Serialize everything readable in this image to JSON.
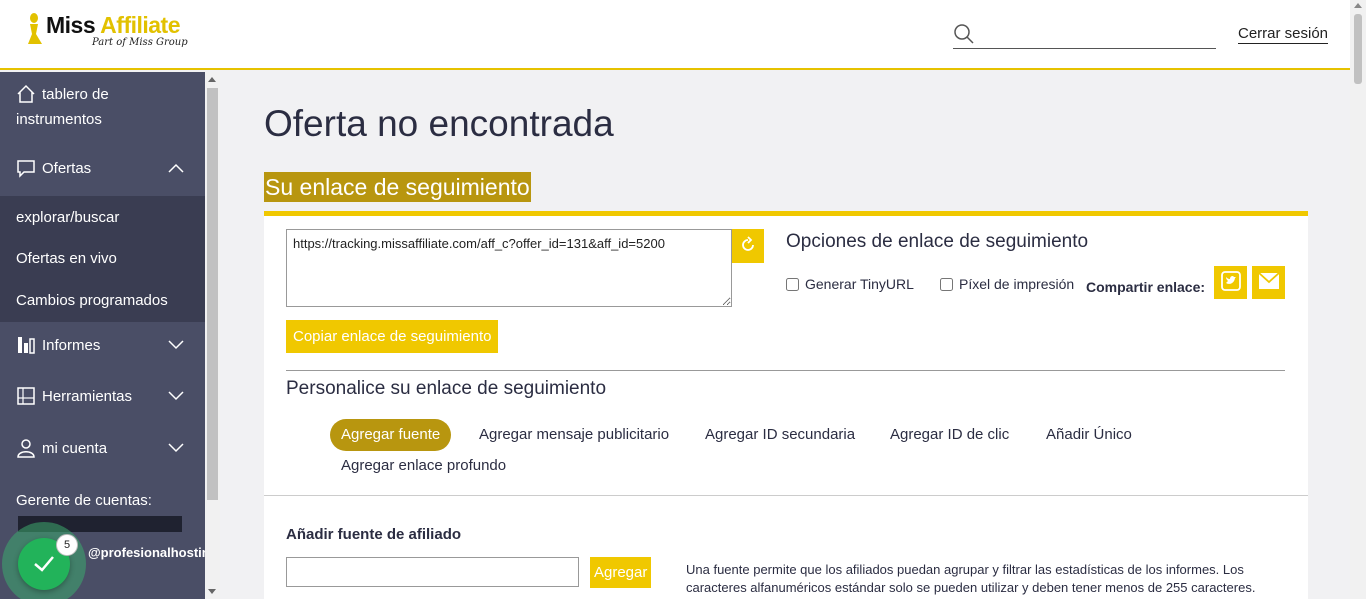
{
  "header": {
    "logo_name_a": "Miss ",
    "logo_name_b": "Affiliate",
    "logo_sub": "Part of Miss Group",
    "search_placeholder": "",
    "logout_label": "Cerrar sesión"
  },
  "sidebar": {
    "dashboard_line1": "tablero de",
    "dashboard_line2": "instrumentos",
    "offers": "Ofertas",
    "offers_sub": [
      "explorar/buscar",
      "Ofertas en vivo",
      "Cambios programados"
    ],
    "reports": "Informes",
    "tools": "Herramientas",
    "account": "mi cuenta",
    "account_manager": "Gerente de cuentas:",
    "account_email": "@profesionalhostin",
    "toast_count": "5"
  },
  "main": {
    "page_title": "Oferta no encontrada",
    "section_title": "Su enlace de seguimiento",
    "tracking_url": "https://tracking.missaffiliate.com/aff_c?offer_id=131&aff_id=5200",
    "copy_label": "Copiar enlace de seguimiento",
    "options_title": "Opciones de enlace de seguimiento",
    "opt_tinyurl": "Generar TinyURL",
    "opt_pixel": "Píxel de impresión",
    "share_label": "Compartir enlace:",
    "customize_title": "Personalice su enlace de seguimiento",
    "pills": [
      "Agregar fuente",
      "Agregar mensaje publicitario",
      "Agregar ID secundaria",
      "Agregar ID de clic",
      "Añadir Único",
      "Agregar enlace profundo"
    ],
    "source_label": "Añadir fuente de afiliado",
    "source_add": "Agregar",
    "source_help": "Una fuente permite que los afiliados puedan agrupar y filtrar las estadísticas de los informes. Los caracteres alfanuméricos estándar solo se pueden utilizar y deben tener menos de 255 caracteres."
  },
  "colors": {
    "accent": "#f0c800",
    "accent_dark": "#b8960f",
    "sidebar": "#4a4e66",
    "sidebar_sub": "#3a3d52",
    "success": "#22b35a"
  }
}
